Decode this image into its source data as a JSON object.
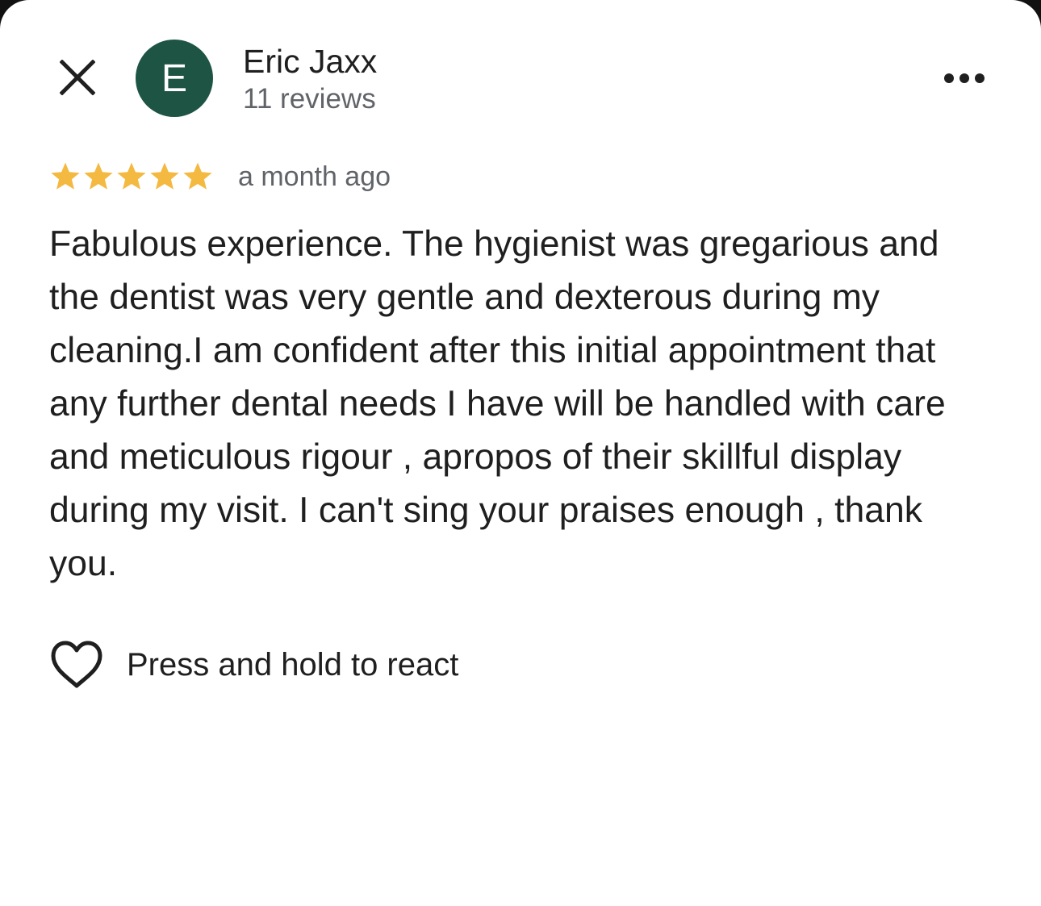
{
  "header": {
    "close_icon": "close-icon",
    "avatar_initial": "E",
    "avatar_color": "#1e5444",
    "reviewer_name": "Eric Jaxx",
    "review_count": "11 reviews",
    "more_icon": "more-horizontal-icon"
  },
  "review": {
    "rating": 5,
    "rating_max": 5,
    "star_color": "#f4b940",
    "time": "a month ago",
    "text": "Fabulous experience. The hygienist was gregarious and the dentist was very gentle and dexterous during my cleaning.I am confident after this initial appointment that any further dental needs I have will be handled with care and meticulous rigour , apropos of their skillful display during my visit. I can't sing your praises enough , thank you."
  },
  "reaction": {
    "icon": "heart-outline-icon",
    "label": "Press and hold to react"
  }
}
